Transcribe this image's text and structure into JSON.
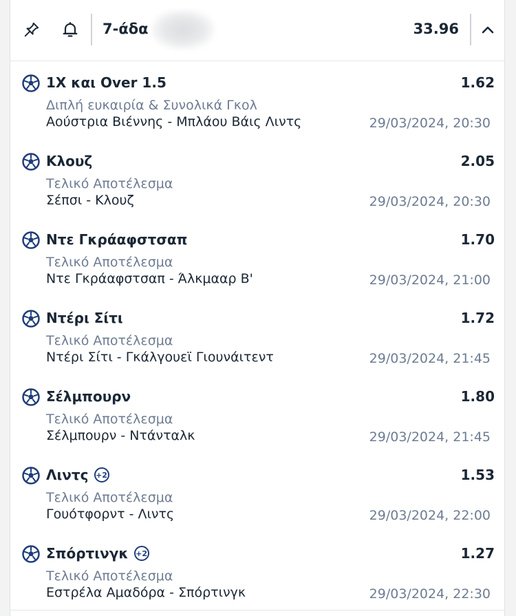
{
  "header": {
    "title": "7-άδα",
    "total_odds": "33.96",
    "icons": [
      "pin-icon",
      "bell-icon",
      "chevron-up-icon"
    ]
  },
  "selections": [
    {
      "name": "1X και Over 1.5",
      "badge": "",
      "odds": "1.62",
      "market": "Διπλή ευκαιρία & Συνολικά Γκολ",
      "event": "Αούστρια Βιέννης - Μπλάου Βάις Λιντς",
      "datetime": "29/03/2024, 20:30"
    },
    {
      "name": "Κλουζ",
      "badge": "",
      "odds": "2.05",
      "market": "Τελικό Αποτέλεσμα",
      "event": "Σέπσι - Κλουζ",
      "datetime": "29/03/2024, 20:30"
    },
    {
      "name": "Ντε Γκράαφστσαπ",
      "badge": "",
      "odds": "1.70",
      "market": "Τελικό Αποτέλεσμα",
      "event": "Ντε Γκράαφστσαπ - Άλκμααρ Β'",
      "datetime": "29/03/2024, 21:00"
    },
    {
      "name": "Ντέρι Σίτι",
      "badge": "",
      "odds": "1.72",
      "market": "Τελικό Αποτέλεσμα",
      "event": "Ντέρι Σίτι - Γκάλγουεϊ Γιουνάιτεντ",
      "datetime": "29/03/2024, 21:45"
    },
    {
      "name": "Σέλμπουρν",
      "badge": "",
      "odds": "1.80",
      "market": "Τελικό Αποτέλεσμα",
      "event": "Σέλμπουρν - Ντάνταλκ",
      "datetime": "29/03/2024, 21:45"
    },
    {
      "name": "Λιντς",
      "badge": "+2",
      "odds": "1.53",
      "market": "Τελικό Αποτέλεσμα",
      "event": "Γουότφορντ - Λιντς",
      "datetime": "29/03/2024, 22:00"
    },
    {
      "name": "Σπόρτινγκ",
      "badge": "+2",
      "odds": "1.27",
      "market": "Τελικό Αποτέλεσμα",
      "event": "Εστρέλα Αμαδόρα - Σπόρτινγκ",
      "datetime": "29/03/2024, 22:30"
    }
  ],
  "colors": {
    "primary_text": "#1b2735",
    "secondary_text": "#6e7c92",
    "badge": "#1f3d7a",
    "ball": "#1f3d7a"
  }
}
